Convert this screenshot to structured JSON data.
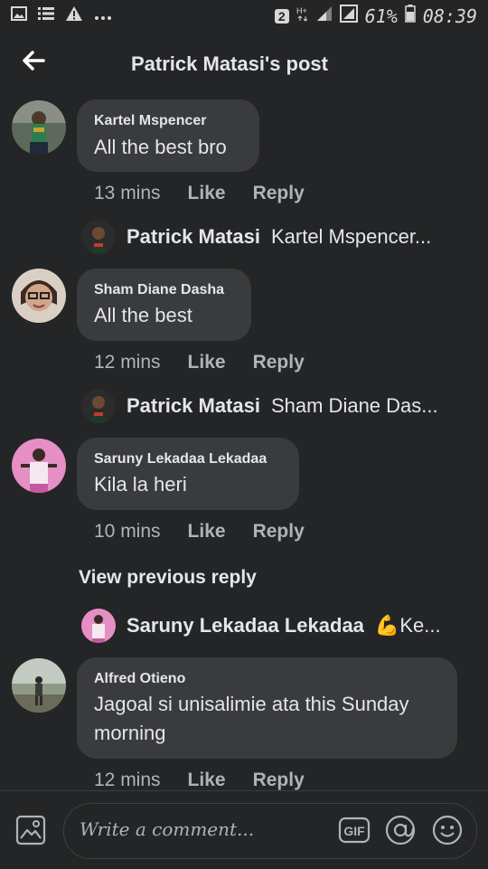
{
  "status_bar": {
    "icons_left": [
      "image-icon",
      "list-icon",
      "warning-icon",
      "more-dots-icon"
    ],
    "sim_badge": "2",
    "battery": "61%",
    "time": "08:39"
  },
  "header": {
    "title": "Patrick Matasi's post"
  },
  "comments": [
    {
      "author": "Kartel Mspencer",
      "text": "All the best bro",
      "time": "13 mins",
      "like": "Like",
      "reply": "Reply",
      "sub_reply": {
        "name": "Patrick Matasi",
        "preview": "Kartel Mspencer..."
      }
    },
    {
      "author": "Sham Diane Dasha",
      "text": "All the best",
      "time": "12 mins",
      "like": "Like",
      "reply": "Reply",
      "sub_reply": {
        "name": "Patrick Matasi",
        "preview": "Sham Diane Das..."
      }
    },
    {
      "author": "Saruny Lekadaa Lekadaa",
      "text": "Kila la heri",
      "time": "10 mins",
      "like": "Like",
      "reply": "Reply",
      "view_previous": "View previous reply",
      "sub_reply": {
        "name": "Saruny Lekadaa Lekadaa",
        "preview": "💪Ke..."
      }
    },
    {
      "author": "Alfred Otieno",
      "text_line1": "Jagoal si unisalimie ata this Sunday",
      "text_line2": "morning",
      "time": "12 mins",
      "like": "Like",
      "reply": "Reply"
    }
  ],
  "composer": {
    "placeholder": "Write a comment...",
    "gif_label": "GIF"
  },
  "colors": {
    "background": "#242526",
    "bubble": "#3a3b3c",
    "text": "#e4e6eb",
    "muted": "#b0b3b8"
  }
}
